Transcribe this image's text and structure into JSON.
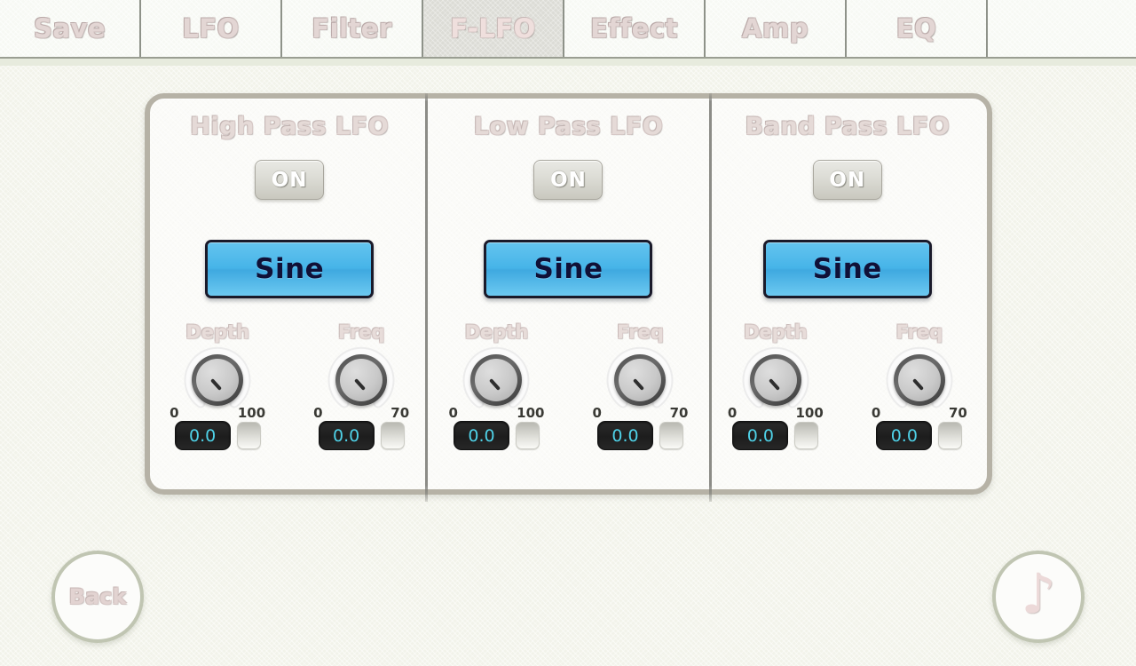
{
  "tabs": [
    {
      "label": "Save",
      "active": false
    },
    {
      "label": "LFO",
      "active": false
    },
    {
      "label": "Filter",
      "active": false
    },
    {
      "label": "F-LFO",
      "active": true
    },
    {
      "label": "Effect",
      "active": false
    },
    {
      "label": "Amp",
      "active": false
    },
    {
      "label": "EQ",
      "active": false
    }
  ],
  "columns": [
    {
      "title": "High Pass LFO",
      "power": "ON",
      "wave": "Sine",
      "knobs": [
        {
          "label": "Depth",
          "min": "0",
          "max": "100",
          "value": "0.0"
        },
        {
          "label": "Freq",
          "min": "0",
          "max": "70",
          "value": "0.0"
        }
      ]
    },
    {
      "title": "Low Pass LFO",
      "power": "ON",
      "wave": "Sine",
      "knobs": [
        {
          "label": "Depth",
          "min": "0",
          "max": "100",
          "value": "0.0"
        },
        {
          "label": "Freq",
          "min": "0",
          "max": "70",
          "value": "0.0"
        }
      ]
    },
    {
      "title": "Band Pass LFO",
      "power": "ON",
      "wave": "Sine",
      "knobs": [
        {
          "label": "Depth",
          "min": "0",
          "max": "100",
          "value": "0.0"
        },
        {
          "label": "Freq",
          "min": "0",
          "max": "70",
          "value": "0.0"
        }
      ]
    }
  ],
  "footer": {
    "back_label": "Back",
    "note_icon": "music-note-icon",
    "note_glyph": "♪"
  },
  "colors": {
    "background": "#f2f3ea",
    "panel_fill": "#fbfbf8",
    "panel_border": "#b6b2a6",
    "tab_active_fill": "#dcdcd6",
    "label_pink": "#e3d6d4",
    "wave_button_blue": "#46b4e8",
    "wave_button_text": "#101037",
    "value_text_cyan": "#4fd2e8",
    "value_box_dark": "#1d1d1d",
    "circle_border": "#c0c5b2"
  }
}
